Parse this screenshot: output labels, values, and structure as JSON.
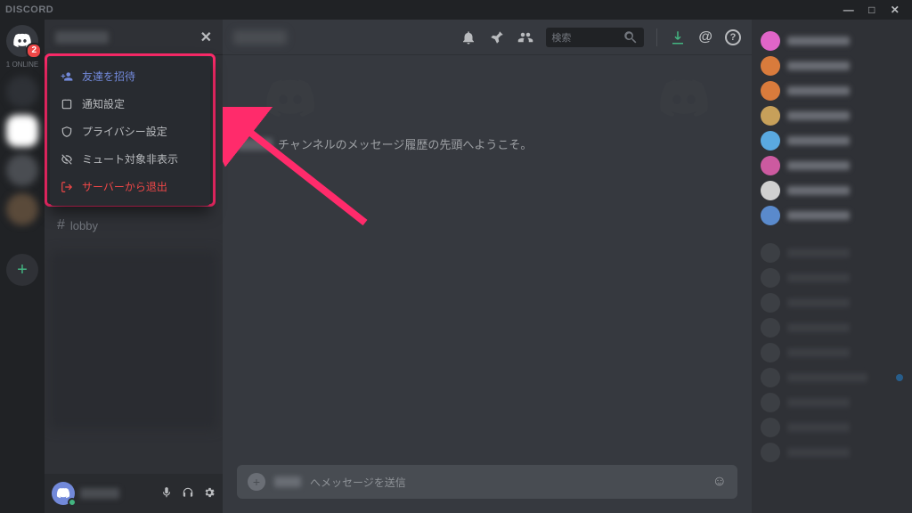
{
  "brand": "DISCORD",
  "window": {
    "min": "—",
    "max": "□",
    "close": "✕"
  },
  "rail": {
    "home_badge": "2",
    "online_label": "1 ONLINE"
  },
  "sidebar": {
    "close_glyph": "✕",
    "channels": [
      {
        "hash": "#",
        "name": "lobby"
      }
    ]
  },
  "dropdown": {
    "invite": "友達を招待",
    "notify": "通知設定",
    "privacy": "プライバシー設定",
    "mute": "ミュート対象非表示",
    "leave": "サーバーから退出"
  },
  "header": {
    "search_placeholder": "検索",
    "at": "@",
    "help": "?"
  },
  "chat": {
    "welcome_suffix": "チャンネルのメッセージ履歴の先頭へようこそ。",
    "input_placeholder": "へメッセージを送信"
  },
  "colors": {
    "accent": "#7289da",
    "danger": "#f04747",
    "highlight": "#ff2b6b"
  }
}
